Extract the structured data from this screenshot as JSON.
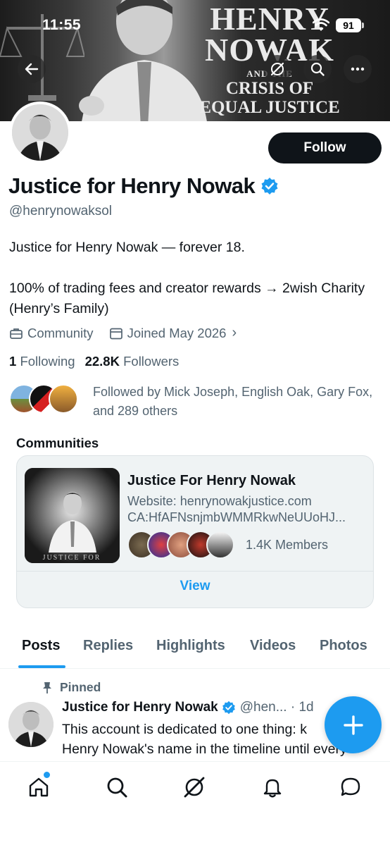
{
  "status_bar": {
    "time": "11:55",
    "battery": "91"
  },
  "banner": {
    "line1": "HENRY",
    "line2": "NOWAK",
    "line3": "AND THE",
    "line4": "CRISIS OF",
    "line5": "EQUAL JUSTICE"
  },
  "profile": {
    "follow_label": "Follow",
    "display_name": "Justice for Henry Nowak",
    "handle": "@henrynowaksol",
    "bio_line1": "Justice for Henry Nowak — forever 18.",
    "bio_line2": "100% of trading fees and creator rewards → 2wish Charity (Henry’s Family)",
    "category": "Community",
    "joined": "Joined May 2026",
    "following_count": "1",
    "following_label": "Following",
    "followers_count": "22.8K",
    "followers_label": "Followers",
    "followed_by": "Followed by Mick Joseph, English Oak, Gary Fox, and 289 others"
  },
  "communities": {
    "heading": "Communities",
    "name": "Justice For Henry Nowak",
    "website": "Website: henrynowakjustice.com",
    "ca": "CA:HfAFNsnjmbWMMRkwNeUUoHJ...",
    "members": "1.4K Members",
    "view_label": "View",
    "thumb_caption": "JUSTICE FOR"
  },
  "tabs": [
    "Posts",
    "Replies",
    "Highlights",
    "Videos",
    "Photos"
  ],
  "post": {
    "pinned_label": "Pinned",
    "name": "Justice for Henry Nowak",
    "handle_time": "@hen... · 1d",
    "text_line1": "This account is dedicated to one thing: k",
    "text_line2": "Henry Nowak's name in the timeline until every"
  },
  "colors": {
    "accent": "#1d9bf0",
    "text": "#0f1419",
    "muted": "#536471"
  }
}
